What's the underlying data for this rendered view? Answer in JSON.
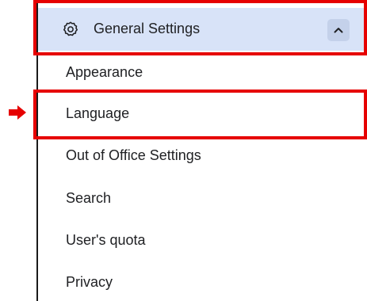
{
  "header": {
    "title": "General Settings",
    "icon": "gear-icon",
    "toggle_icon": "chevron-up-icon"
  },
  "items": [
    {
      "label": "Appearance"
    },
    {
      "label": "Language"
    },
    {
      "label": "Out of Office Settings"
    },
    {
      "label": "Search"
    },
    {
      "label": "User's quota"
    },
    {
      "label": "Privacy"
    }
  ],
  "colors": {
    "header_bg": "#d8e3f8",
    "highlight": "#e60000",
    "text": "#202124"
  }
}
